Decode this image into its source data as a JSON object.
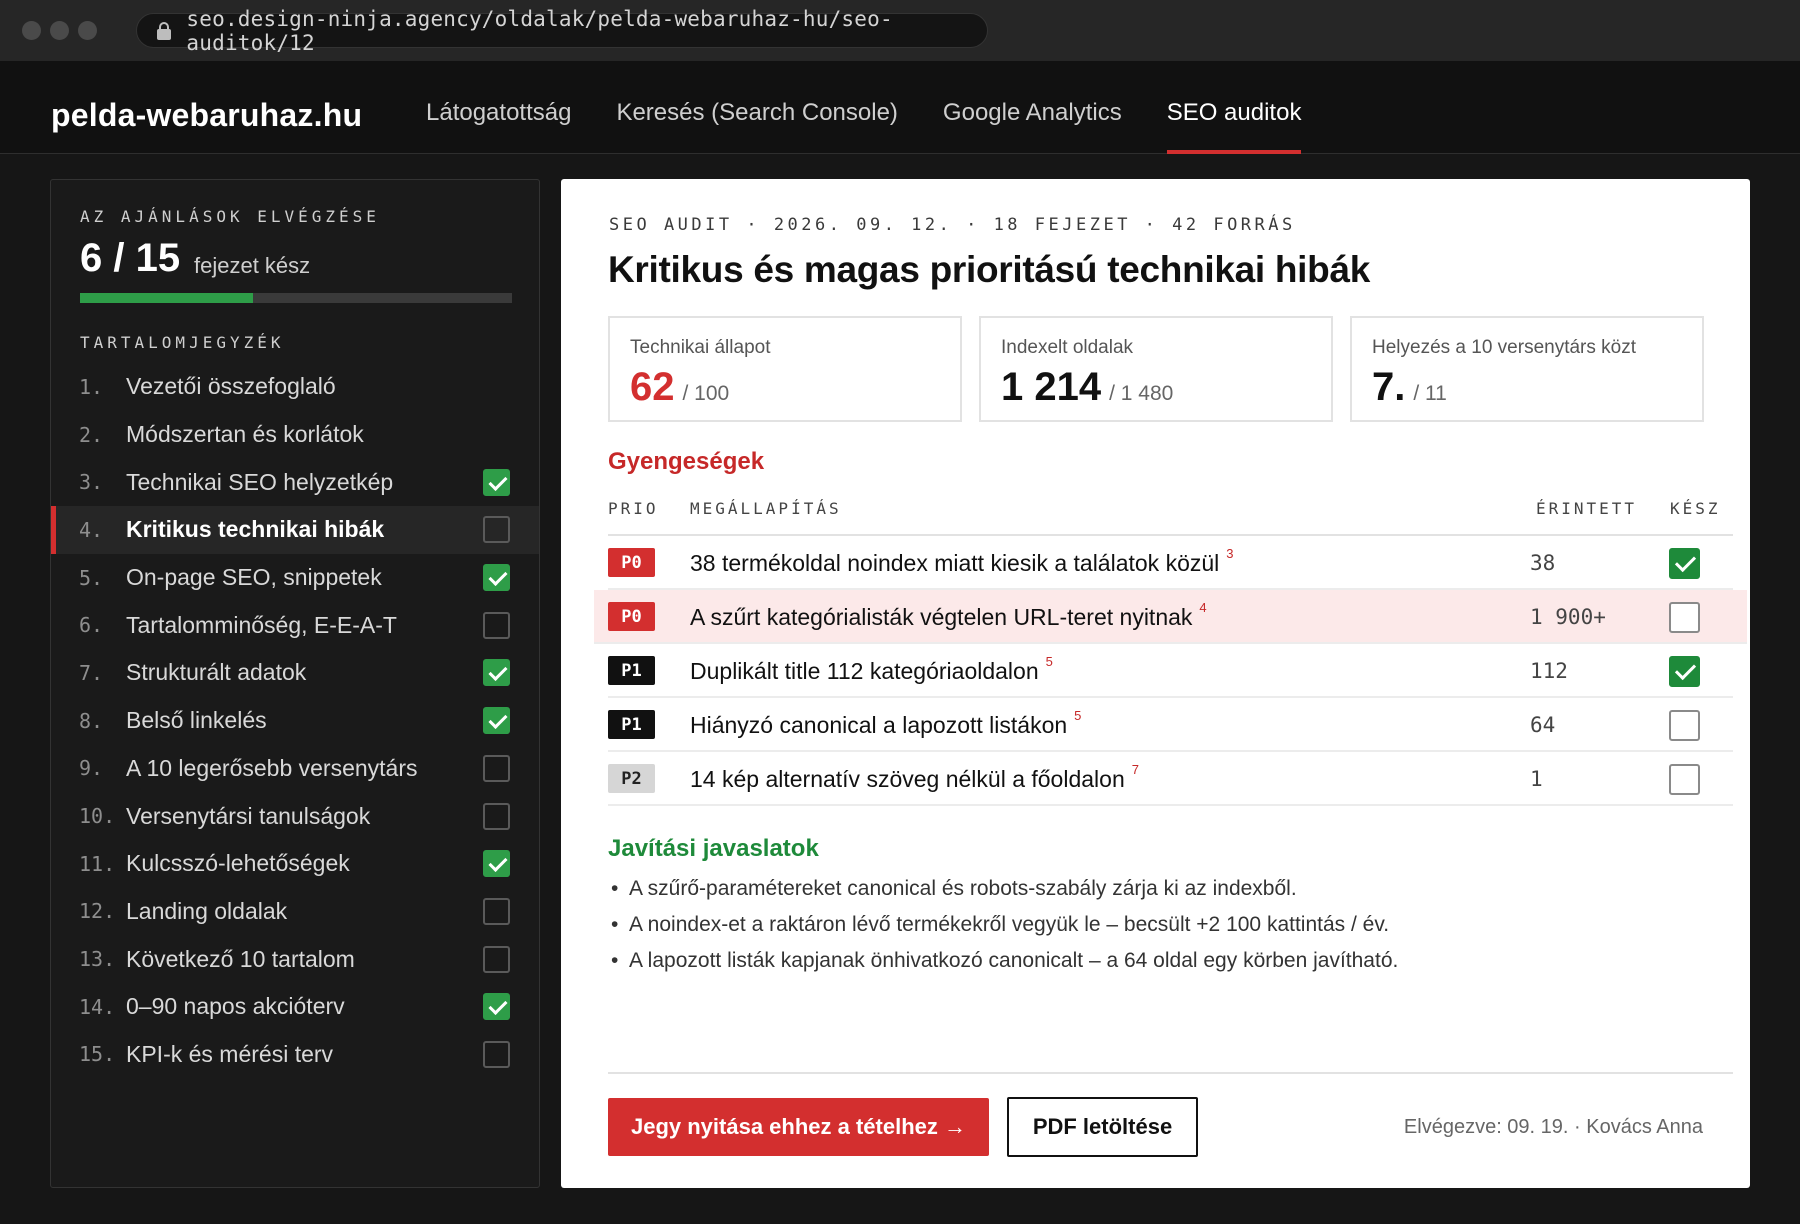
{
  "browser": {
    "url": "seo.design-ninja.agency/oldalak/pelda-webaruhaz-hu/seo-auditok/12"
  },
  "header": {
    "brand": "pelda-webaruhaz.hu",
    "tabs": [
      {
        "label": "Látogatottság",
        "active": false
      },
      {
        "label": "Keresés (Search Console)",
        "active": false
      },
      {
        "label": "Google Analytics",
        "active": false
      },
      {
        "label": "SEO auditok",
        "active": true
      }
    ]
  },
  "sidebar": {
    "progress_caption": "AZ AJÁNLÁSOK ELVÉGZÉSE",
    "progress_value": "6 / 15",
    "progress_suffix": "fejezet kész",
    "progress_fraction": 0.4,
    "toc_caption": "TARTALOMJEGYZÉK",
    "items": [
      {
        "num": "1.",
        "label": "Vezetői összefoglaló",
        "checkbox": false
      },
      {
        "num": "2.",
        "label": "Módszertan és korlátok",
        "checkbox": false
      },
      {
        "num": "3.",
        "label": "Technikai SEO helyzetkép",
        "checkbox": true,
        "done": true
      },
      {
        "num": "4.",
        "label": "Kritikus technikai hibák",
        "checkbox": true,
        "done": false,
        "active": true
      },
      {
        "num": "5.",
        "label": "On-page SEO, snippetek",
        "checkbox": true,
        "done": true
      },
      {
        "num": "6.",
        "label": "Tartalomminőség, E-E-A-T",
        "checkbox": true,
        "done": false
      },
      {
        "num": "7.",
        "label": "Strukturált adatok",
        "checkbox": true,
        "done": true
      },
      {
        "num": "8.",
        "label": "Belső linkelés",
        "checkbox": true,
        "done": true
      },
      {
        "num": "9.",
        "label": "A 10 legerősebb versenytárs",
        "checkbox": true,
        "done": false
      },
      {
        "num": "10.",
        "label": "Versenytársi tanulságok",
        "checkbox": true,
        "done": false
      },
      {
        "num": "11.",
        "label": "Kulcsszó-lehetőségek",
        "checkbox": true,
        "done": true
      },
      {
        "num": "12.",
        "label": "Landing oldalak",
        "checkbox": true,
        "done": false
      },
      {
        "num": "13.",
        "label": "Következő 10 tartalom",
        "checkbox": true,
        "done": false
      },
      {
        "num": "14.",
        "label": "0–90 napos akcióterv",
        "checkbox": true,
        "done": true
      },
      {
        "num": "15.",
        "label": "KPI-k és mérési terv",
        "checkbox": true,
        "done": false
      }
    ]
  },
  "main": {
    "meta": "SEO AUDIT · 2026. 09. 12. · 18 FEJEZET · 42 FORRÁS",
    "title": "Kritikus és magas prioritású technikai hibák",
    "kpis": [
      {
        "label": "Technikai állapot",
        "value": "62",
        "sub": "/ 100",
        "accent": "#d32f2f"
      },
      {
        "label": "Indexelt oldalak",
        "value": "1 214",
        "sub": "/ 1 480"
      },
      {
        "label": "Helyezés a 10 versenytárs közt",
        "value": "7.",
        "sub": "/ 11"
      }
    ],
    "weaknesses_title": "Gyengeségek",
    "columns": {
      "prio": "PRIO",
      "finding": "MEGÁLLAPÍTÁS",
      "affected": "ÉRINTETT",
      "done": "KÉSZ"
    },
    "rows": [
      {
        "prio": "P0",
        "text": "38 termékoldal noindex miatt kiesik a találatok közül",
        "ref": "3",
        "affected": "38",
        "done": true
      },
      {
        "prio": "P0",
        "text": "A szűrt kategórialisták végtelen URL-teret nyitnak",
        "ref": "4",
        "affected": "1 900+",
        "done": false,
        "highlight": true
      },
      {
        "prio": "P1",
        "text": "Duplikált title 112 kategóriaoldalon",
        "ref": "5",
        "affected": "112",
        "done": true
      },
      {
        "prio": "P1",
        "text": "Hiányzó canonical a lapozott listákon",
        "ref": "5",
        "affected": "64",
        "done": false
      },
      {
        "prio": "P2",
        "text": "14 kép alternatív szöveg nélkül a főoldalon",
        "ref": "7",
        "affected": "1",
        "done": false
      }
    ],
    "fixes_title": "Javítási javaslatok",
    "fixes": [
      "A szűrő-paramétereket canonical és robots-szabály zárja ki az indexből.",
      "A noindex-et a raktáron lévő termékekről vegyük le – becsült +2 100 kattintás / év.",
      "A lapozott listák kapjanak önhivatkozó canonicalt – a 64 oldal egy körben javítható."
    ],
    "primary_button": "Jegy nyitása ehhez a tételhez →",
    "secondary_button": "PDF letöltése",
    "done_note": "Elvégezve: 09. 19. · Kovács Anna"
  },
  "colors": {
    "accent_red": "#d32f2f",
    "success_green": "#2e9d48",
    "dark_bg": "#161616"
  }
}
